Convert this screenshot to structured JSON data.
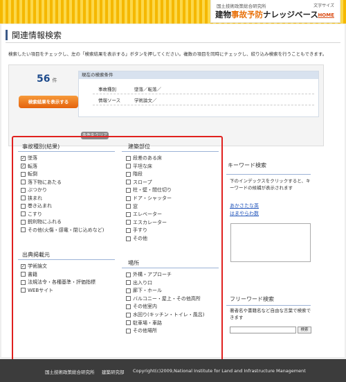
{
  "header": {
    "institute": "国土技術政策総合研究所",
    "font_size_label": "文字サイズ",
    "title_pre": "建物",
    "title_accent": "事故予防",
    "title_post": "ナレッジベース",
    "home": "HOME"
  },
  "page": {
    "title": "関連情報検索",
    "intro": "検索したい項目をチェックし、左の「検索結果を表示する」ボタンを押してください。複数の項目を同時にチェックし、絞り込み検索を行うこともできます。"
  },
  "results": {
    "count": "56",
    "unit": "件",
    "show_button": "検索結果を表示する",
    "conditions_title": "現在の検索条件",
    "conditions": [
      {
        "key": "事故種別",
        "value": "墜落／転落／"
      },
      {
        "key": "情報ソース",
        "value": "学術論文／"
      }
    ],
    "clear_button": "条件をクリア"
  },
  "accident_type": {
    "title": "事故種別(結果)",
    "items": [
      {
        "label": "墜落",
        "checked": true
      },
      {
        "label": "転落",
        "checked": true
      },
      {
        "label": "転倒",
        "checked": false
      },
      {
        "label": "落下物にあたる",
        "checked": false
      },
      {
        "label": "ぶつかり",
        "checked": false
      },
      {
        "label": "挟まれ",
        "checked": false
      },
      {
        "label": "巻き込まれ",
        "checked": false
      },
      {
        "label": "こすり",
        "checked": false
      },
      {
        "label": "鋭利物にふれる",
        "checked": false
      },
      {
        "label": "その他(火傷・感電・閉じ込めなど)",
        "checked": false
      }
    ]
  },
  "building_part": {
    "title": "建築部位",
    "items": [
      {
        "label": "段差のある床",
        "checked": false
      },
      {
        "label": "平坦な床",
        "checked": false
      },
      {
        "label": "階段",
        "checked": false
      },
      {
        "label": "スロープ",
        "checked": false
      },
      {
        "label": "柱・壁・間仕切り",
        "checked": false
      },
      {
        "label": "ドア・シャッター",
        "checked": false
      },
      {
        "label": "窓",
        "checked": false
      },
      {
        "label": "エレベーター",
        "checked": false
      },
      {
        "label": "エスカレーター",
        "checked": false
      },
      {
        "label": "手すり",
        "checked": false
      },
      {
        "label": "その他",
        "checked": false
      }
    ]
  },
  "source": {
    "title": "出典掲載元",
    "items": [
      {
        "label": "学術論文",
        "checked": true
      },
      {
        "label": "書籍",
        "checked": false
      },
      {
        "label": "法規法令・各種基準・評価指標",
        "checked": false
      },
      {
        "label": "WEBサイト",
        "checked": false
      }
    ]
  },
  "place": {
    "title": "場所",
    "items": [
      {
        "label": "外構・アプローチ",
        "checked": false
      },
      {
        "label": "出入り口",
        "checked": false
      },
      {
        "label": "廊下・ホール",
        "checked": false
      },
      {
        "label": "バルコニー・屋上・その他高所",
        "checked": false
      },
      {
        "label": "その他室内",
        "checked": false
      },
      {
        "label": "水回り(キッチン・トイレ・風呂)",
        "checked": false
      },
      {
        "label": "駐車場・車路",
        "checked": false
      },
      {
        "label": "その他場所",
        "checked": false
      }
    ]
  },
  "keyword": {
    "title": "キーワード検索",
    "description": "下のインデックスをクリックすると、キーワードの候補が表示されます",
    "index_rows": [
      "あかさたな英",
      "はまやらわ数"
    ]
  },
  "freeword": {
    "title": "フリーワード検索",
    "description": "著者名や書籍名など自由な言葉で検索できます",
    "button": "検索"
  },
  "footer": {
    "institute": "国土技術政策総合研究所",
    "dept": "建築研究部",
    "copyright": "Copyright(c)2009,National Institute for Land and Infrastructure Management"
  }
}
